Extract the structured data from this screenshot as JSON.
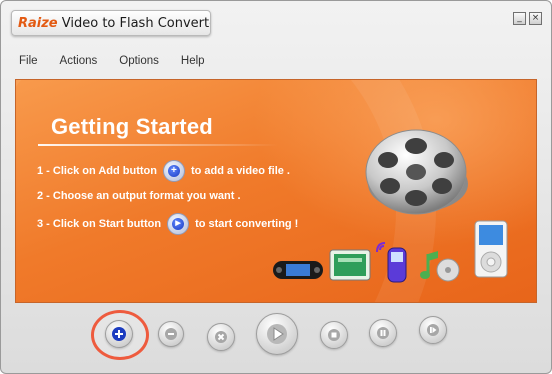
{
  "window": {
    "brand": "Raize",
    "title": " Video to Flash Converter",
    "minimize_glyph": "_",
    "close_glyph": "×"
  },
  "menu": {
    "items": [
      "File",
      "Actions",
      "Options",
      "Help"
    ]
  },
  "banner": {
    "heading": "Getting Started",
    "steps": [
      {
        "before": "1 - Click on Add button",
        "after": "to add a video file .",
        "icon": "add-icon",
        "glyph": "+"
      },
      {
        "before": "2 - Choose an output format you want .",
        "after": "",
        "icon": "",
        "glyph": ""
      },
      {
        "before": "3 - Click on Start button",
        "after": "to start converting !",
        "icon": "play-icon",
        "glyph": "▶"
      }
    ],
    "graphics": [
      "film-reel-icon",
      "psp-device-icon",
      "tablet-device-icon",
      "mobile-phone-icon",
      "music-note-icon",
      "ipod-device-icon"
    ]
  },
  "toolbar": {
    "buttons": [
      "add",
      "remove",
      "clear",
      "start",
      "stop",
      "pause",
      "resume"
    ],
    "highlight": "add",
    "highlight_color": "#ee5b3e"
  },
  "colors": {
    "banner_orange": "#f07a2a",
    "brand_orange": "#e35a12",
    "icon_blue": "#1c3cc0"
  }
}
